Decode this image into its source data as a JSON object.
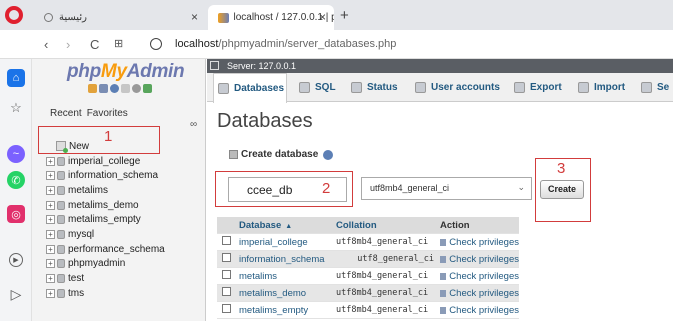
{
  "browser": {
    "inactive_tab": "رئيسية",
    "active_tab": "localhost / 127.0.0.1 | phpM",
    "url_host": "localhost",
    "url_path": "/phpmyadmin/server_databases.php"
  },
  "colors": {
    "accent_blue": "#235a81",
    "annotation_red": "#d23c3c",
    "logo_php": "#6c78af",
    "logo_my": "#f89c0e"
  },
  "nav": {
    "logo_php": "php",
    "logo_my": "My",
    "logo_admin": "Admin",
    "recent": "Recent",
    "favorites": "Favorites",
    "new_label": "New",
    "databases": [
      "imperial_college",
      "information_schema",
      "metalims",
      "metalims_demo",
      "metalims_empty",
      "mysql",
      "performance_schema",
      "phpmyadmin",
      "test",
      "tms"
    ]
  },
  "server": {
    "label": "Server: 127.0.0.1"
  },
  "menu": [
    {
      "label": "Databases"
    },
    {
      "label": "SQL"
    },
    {
      "label": "Status"
    },
    {
      "label": "User accounts"
    },
    {
      "label": "Export"
    },
    {
      "label": "Import"
    },
    {
      "label": "Se"
    }
  ],
  "main": {
    "title": "Databases",
    "create_label": "Create database",
    "db_name_value": "ccee_db",
    "collation_value": "utf8mb4_general_ci",
    "create_button": "Create"
  },
  "annotations": [
    "1",
    "2",
    "3"
  ],
  "table": {
    "headers": {
      "database": "Database",
      "collation": "Collation",
      "action": "Action"
    },
    "rows": [
      {
        "db": "imperial_college",
        "collation": "utf8mb4_general_ci",
        "action": "Check privileges"
      },
      {
        "db": "information_schema",
        "collation": "utf8_general_ci",
        "action": "Check privileges"
      },
      {
        "db": "metalims",
        "collation": "utf8mb4_general_ci",
        "action": "Check privileges"
      },
      {
        "db": "metalims_demo",
        "collation": "utf8mb4_general_ci",
        "action": "Check privileges"
      },
      {
        "db": "metalims_empty",
        "collation": "utf8mb4_general_ci",
        "action": "Check privileges"
      }
    ]
  }
}
